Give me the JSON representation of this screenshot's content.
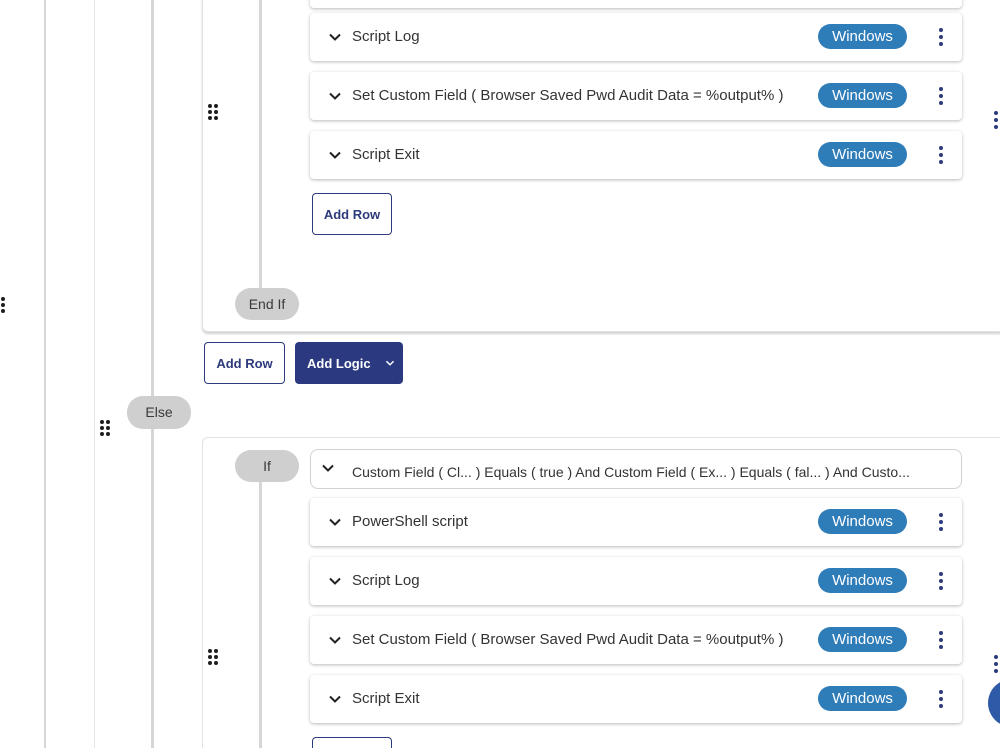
{
  "steps_upper": [
    {
      "label": "Script Log",
      "os": "Windows"
    },
    {
      "label": "Set Custom Field ( Browser Saved Pwd Audit Data = %output% )",
      "os": "Windows"
    },
    {
      "label": "Script Exit",
      "os": "Windows"
    }
  ],
  "steps_lower": [
    {
      "label": "PowerShell script",
      "os": "Windows"
    },
    {
      "label": "Script Log",
      "os": "Windows"
    },
    {
      "label": "Set Custom Field ( Browser Saved Pwd Audit Data = %output% )",
      "os": "Windows"
    },
    {
      "label": "Script Exit",
      "os": "Windows"
    }
  ],
  "buttons": {
    "add_row": "Add Row",
    "add_logic": "Add Logic"
  },
  "tags": {
    "end_if": "End If",
    "else": "Else",
    "if": "If"
  },
  "condition": {
    "text": "Custom Field ( Cl...  ) Equals ( true ) And Custom Field ( Ex...  ) Equals ( fal...  ) And Custo..."
  },
  "colors": {
    "badge": "#2e7cb8",
    "primary": "#2b3a80",
    "pill": "#cfcfcf"
  },
  "icons": {
    "expand": "chevron-down-icon",
    "menu": "kebab-menu-icon",
    "drag": "drag-handle-icon"
  }
}
